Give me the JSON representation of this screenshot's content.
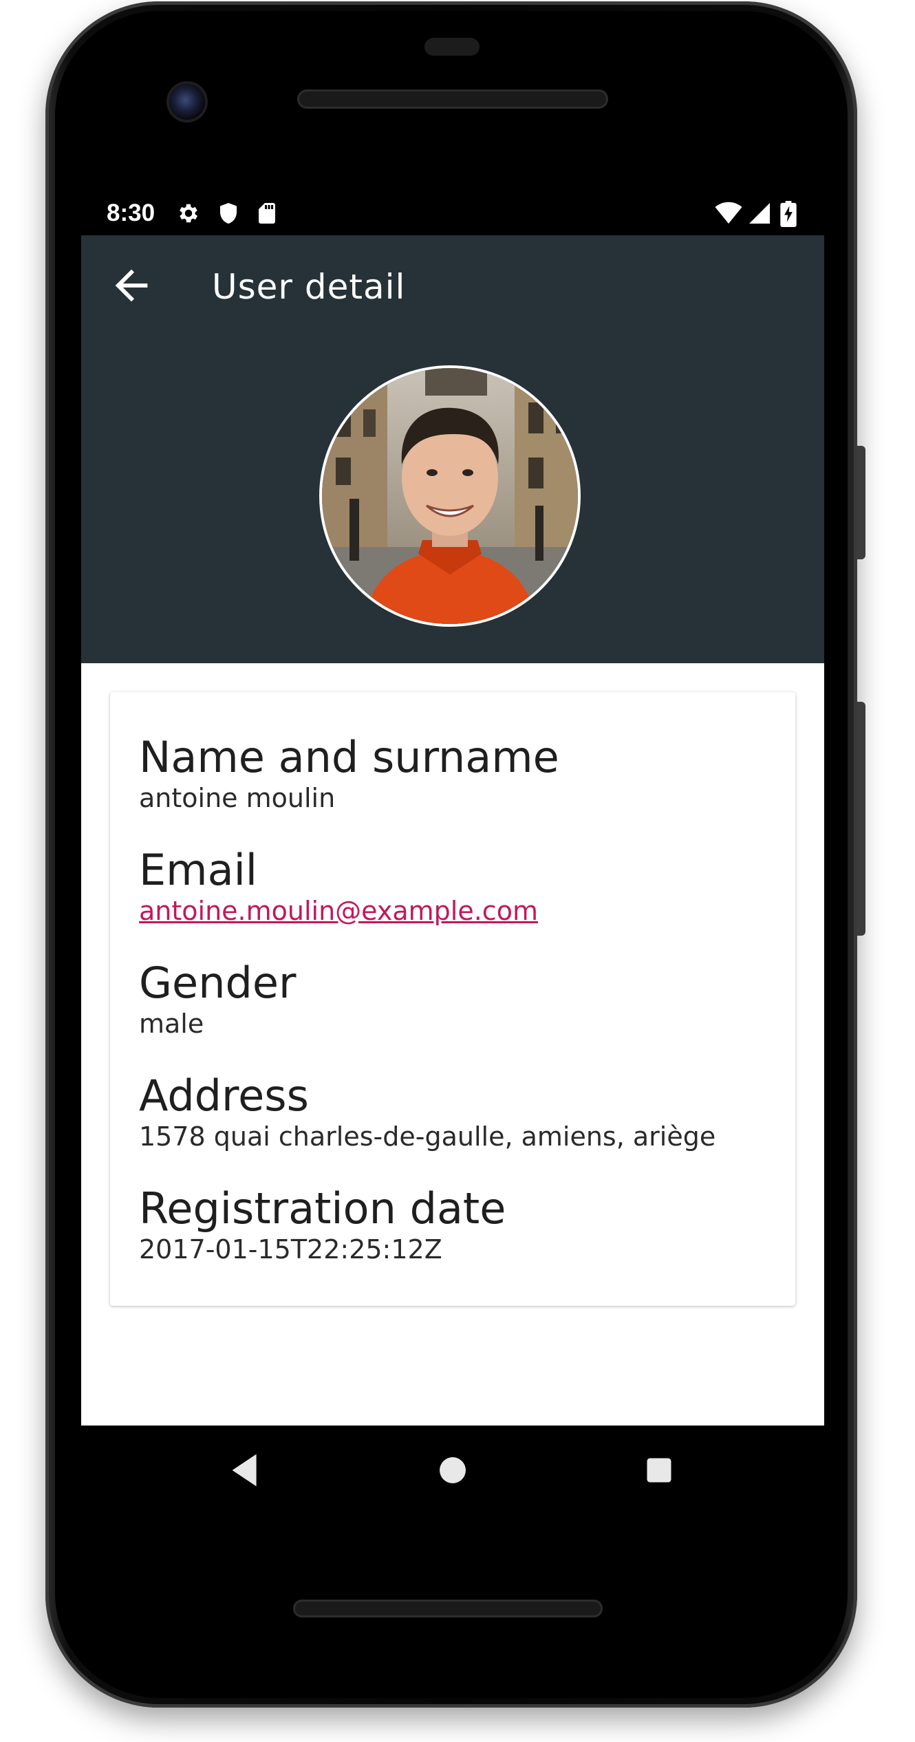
{
  "status_bar": {
    "time": "8:30",
    "left_icons": [
      "gear-icon",
      "shield-icon",
      "sd-card-icon"
    ],
    "right_icons": [
      "wifi-icon",
      "cell-signal-icon",
      "battery-charging-icon"
    ]
  },
  "app_bar": {
    "title": "User detail",
    "back_icon": "arrow-back-icon"
  },
  "colors": {
    "primary": "#263238",
    "accent_link": "#c2185b",
    "surface": "#ffffff"
  },
  "profile": {
    "avatar": "user-photo"
  },
  "details": [
    {
      "label": "Name and surname",
      "value": "antoine moulin",
      "is_link": false
    },
    {
      "label": "Email",
      "value": "antoine.moulin@example.com",
      "is_link": true
    },
    {
      "label": "Gender",
      "value": "male",
      "is_link": false
    },
    {
      "label": "Address",
      "value": "1578 quai charles-de-gaulle, amiens, ariège",
      "is_link": false
    },
    {
      "label": "Registration date",
      "value": "2017-01-15T22:25:12Z",
      "is_link": false
    }
  ],
  "nav_bar": {
    "buttons": [
      "back-triangle-icon",
      "home-circle-icon",
      "recents-square-icon"
    ]
  }
}
